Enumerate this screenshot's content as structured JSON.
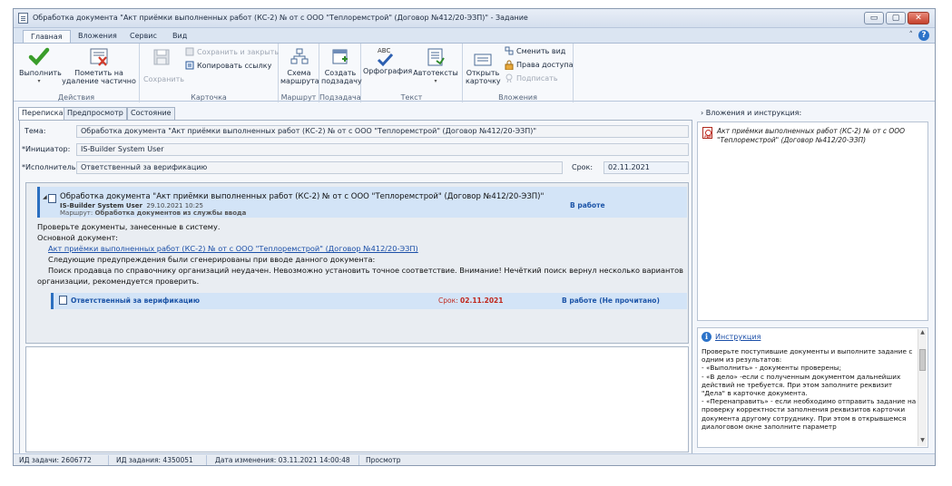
{
  "window": {
    "title": "Обработка документа \"Акт приёмки выполненных работ (КС-2) № от  с ООО \"Теплоремстрой\" (Договор №412/20-ЭЗП)\" - Задание",
    "min_label": "▭",
    "max_label": "▢",
    "close_label": "✕"
  },
  "ribbon_tabs": [
    "Главная",
    "Вложения",
    "Сервис",
    "Вид"
  ],
  "ribbon": {
    "actions": {
      "group_label": "Действия",
      "execute": "Выполнить",
      "mark_delete_1": "Пометить на",
      "mark_delete_2": "удаление частично"
    },
    "card": {
      "group_label": "Карточка",
      "save": "Сохранить",
      "save_close": "Сохранить и закрыть",
      "copy_link": "Копировать ссылку"
    },
    "route": {
      "group_label": "Маршрут",
      "scheme_1": "Схема",
      "scheme_2": "маршрута"
    },
    "subtask": {
      "group_label": "Подзадача",
      "create_1": "Создать",
      "create_2": "подзадачу"
    },
    "text": {
      "group_label": "Текст",
      "spelling": "Орфография",
      "autotext": "Автотексты",
      "abc": "ABC"
    },
    "attachments": {
      "group_label": "Вложения",
      "open_card_1": "Открыть",
      "open_card_2": "карточку",
      "change_view": "Сменить вид",
      "access_rights": "Права доступа",
      "sign": "Подписать"
    }
  },
  "form_tabs": [
    "Переписка",
    "Предпросмотр",
    "Состояние"
  ],
  "form": {
    "subject_label": "Тема:",
    "subject_value": "Обработка документа \"Акт приёмки выполненных работ (КС-2) № от  с ООО \"Теплоремстрой\" (Договор №412/20-ЭЗП)\"",
    "initiator_label": "*Инициатор:",
    "initiator_value": "IS-Builder System User",
    "executor_label": "*Исполнитель:",
    "executor_value": "Ответственный за верификацию",
    "due_label": "Срок:",
    "due_value": "02.11.2021"
  },
  "thread": {
    "expander": "◢",
    "title": "Обработка документа \"Акт приёмки выполненных работ (КС-2) № от с ООО \"Теплоремстрой\" (Договор №412/20-ЭЗП)\"",
    "author": "IS-Builder System User",
    "date": "29.10.2021 10:25",
    "route_label": "Маршрут:",
    "route_value": "Обработка документов из службы ввода",
    "status": "В работе",
    "body_line1": "Проверьте документы, занесенные в систему.",
    "body_line2": "Основной документ:",
    "doc_link": "Акт приёмки выполненных работ (КС-2) № от  с ООО \"Теплоремстрой\" (Договор №412/20-ЭЗП)",
    "body_line3": "Следующие предупреждения были сгенерированы при вводе данного документа:",
    "body_line4": "Поиск продавца по справочнику организаций неудачен. Невозможно установить точное соответствие. Внимание! Нечёткий поиск вернул несколько вариантов",
    "body_line5": "организации, рекомендуется проверить.",
    "subtask_who": "Ответственный за верификацию",
    "subtask_due_label": "Срок:",
    "subtask_due_value": "02.11.2021",
    "subtask_status": "В работе (Не прочитано)"
  },
  "right_pane": {
    "header": "Вложения и инструкция:",
    "attachment": "Акт приёмки выполненных работ (КС-2) № от  с ООО \"Теплоремстрой\" (Договор №412/20-ЭЗП)",
    "instruction_link": "Инструкция",
    "instruction_lines": [
      "Проверьте поступившие документы и выполните задание с одним из результатов:",
      "- «Выполнить» - документы проверены;",
      "- «В дело» -если с полученным документом дальнейших действий не требуется. При этом заполните реквизит \"Дела\" в карточке документа.",
      "- «Перенаправить» - если необходимо отправить задание на проверку корректности заполнения реквизитов карточки документа другому сотруднику. При этом в открывшемся диалоговом окне заполните параметр"
    ]
  },
  "statusbar": {
    "task_id": "ИД задачи: 2606772",
    "job_id": "ИД задания: 4350051",
    "changed": "Дата изменения: 03.11.2021 14:00:48",
    "mode": "Просмотр"
  },
  "colors": {
    "accent": "#2b6fc0",
    "due_red": "#c0261c",
    "status_blue": "#1d55a8",
    "highlight": "#d3e4f7"
  }
}
